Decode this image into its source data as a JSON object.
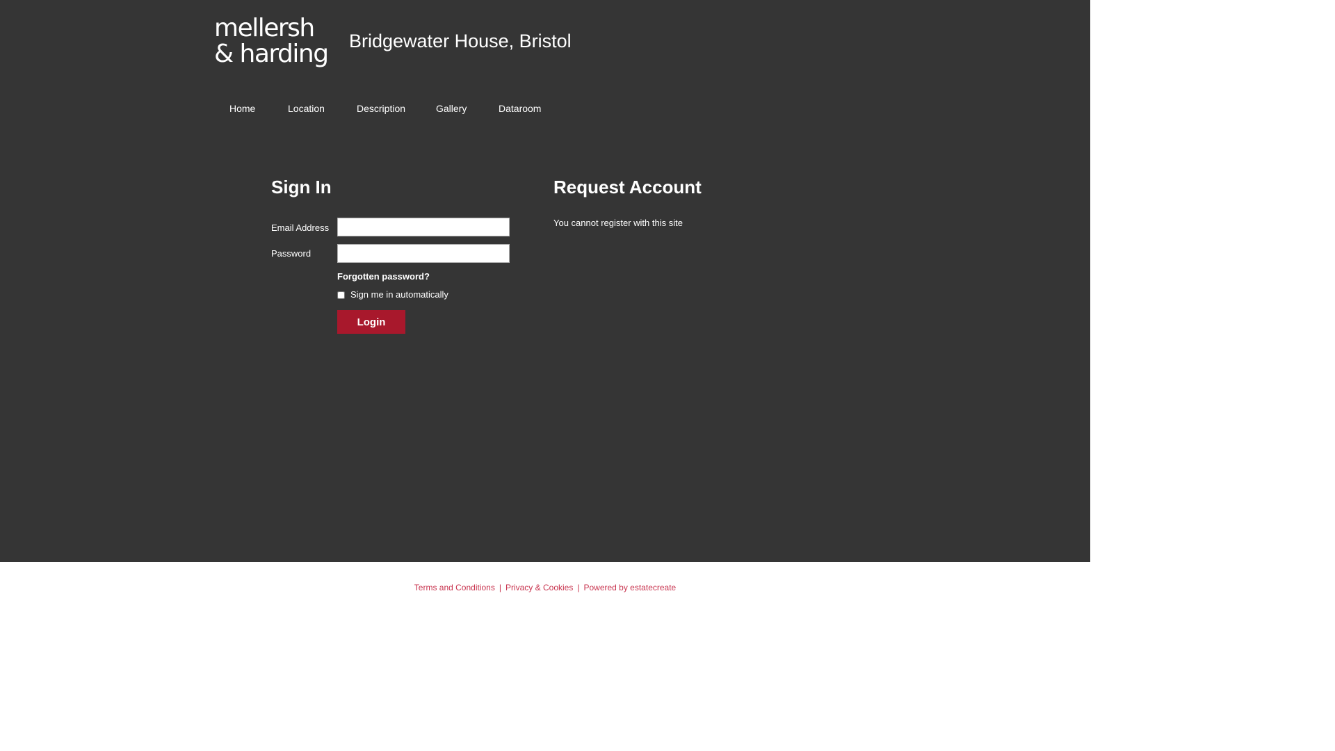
{
  "header": {
    "logo_line1": "mellersh",
    "logo_line2": "& harding",
    "site_title": "Bridgewater House, Bristol"
  },
  "nav": {
    "items": [
      {
        "label": "Home"
      },
      {
        "label": "Location"
      },
      {
        "label": "Description"
      },
      {
        "label": "Gallery"
      },
      {
        "label": "Dataroom"
      }
    ]
  },
  "signin": {
    "title": "Sign In",
    "email_label": "Email Address",
    "email_value": "",
    "password_label": "Password",
    "password_value": "",
    "forgot_link": "Forgotten password?",
    "remember_label": "Sign me in automatically",
    "remember_checked": false,
    "login_button": "Login"
  },
  "request": {
    "title": "Request Account",
    "note": "You cannot register with this site"
  },
  "footer": {
    "links": [
      {
        "label": "Terms and Conditions"
      },
      {
        "label": "Privacy & Cookies"
      },
      {
        "label": "Powered by estatecreate"
      }
    ],
    "separator": "|"
  },
  "colors": {
    "background": "#353535",
    "accent_button": "#a8182c",
    "footer_link": "#c8334e"
  }
}
